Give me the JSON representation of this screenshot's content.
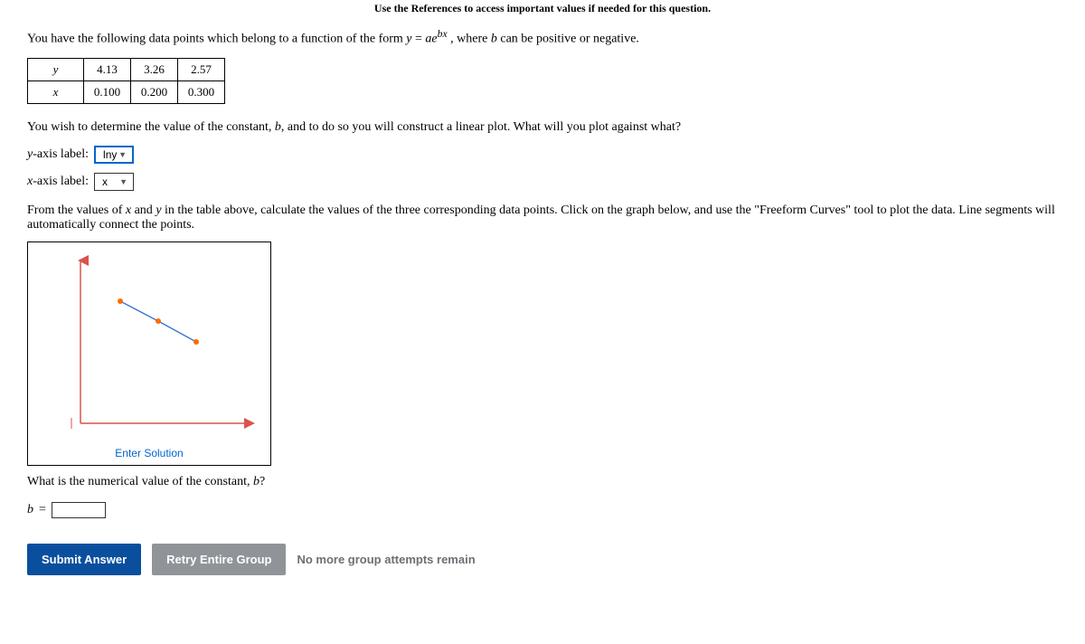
{
  "top_hint": "Use the References to access important values if needed for this question.",
  "intro_pre": "You have the following data points which belong to a function of the form ",
  "intro_eq_y": "y",
  "intro_eq_eq": " = ",
  "intro_eq_a": "ae",
  "intro_eq_exp": "bx",
  "intro_post": " , where ",
  "intro_bvar": "b",
  "intro_post2": " can be positive or negative.",
  "table": {
    "row1_h": "y",
    "row1": [
      "4.13",
      "3.26",
      "2.57"
    ],
    "row2_h": "x",
    "row2": [
      "0.100",
      "0.200",
      "0.300"
    ]
  },
  "determine_pre": "You wish to determine the value of the constant, ",
  "determine_b": "b",
  "determine_post": ", and to do so you will construct a linear plot. What will you plot against what?",
  "yaxis_label_pre": "y",
  "yaxis_label_post": "-axis label:",
  "yaxis_value": "lny",
  "xaxis_label_pre": "x",
  "xaxis_label_post": "-axis label:",
  "xaxis_value": "x",
  "instr_pre": "From the values of ",
  "instr_x": "x",
  "instr_mid1": " and ",
  "instr_y": "y",
  "instr_mid2": " in the table above, calculate the values of the three corresponding data points. Click on the graph below, and use the \"Freeform Curves\" tool to plot the data. Line segments will automatically connect the points.",
  "enter_solution": "Enter Solution",
  "constb_pre": "What is the numerical value of the constant, ",
  "constb_b": "b",
  "constb_post": "?",
  "b_eq_label": "b",
  "b_eq_sign": " = ",
  "b_value": "",
  "submit": "Submit Answer",
  "retry": "Retry Entire Group",
  "status": "No more group attempts remain",
  "chart_data": {
    "type": "scatter",
    "series": [
      {
        "name": "points",
        "x": [
          0.1,
          0.2,
          0.3
        ],
        "y": [
          1.418,
          1.182,
          0.944
        ]
      }
    ],
    "xlim": [
      0,
      0.35
    ],
    "ylim": [
      0,
      1.6
    ],
    "xlabel": "",
    "ylabel": "",
    "title": ""
  }
}
